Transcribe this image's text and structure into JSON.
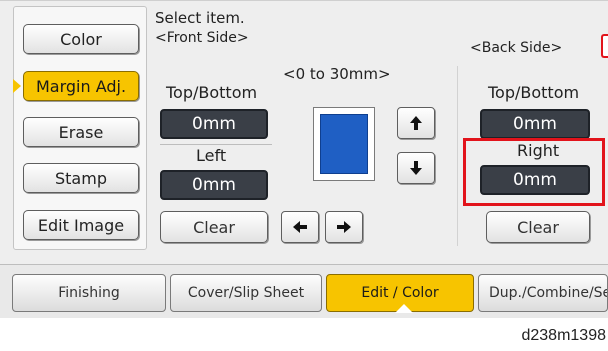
{
  "sidebar": {
    "items": [
      {
        "label": "Color"
      },
      {
        "label": "Margin Adj."
      },
      {
        "label": "Erase"
      },
      {
        "label": "Stamp"
      },
      {
        "label": "Edit Image"
      }
    ]
  },
  "header": {
    "instruction_line1": "Select item.",
    "instruction_line2": "<Front Side>",
    "range": "<0 to 30mm>",
    "back_side": "<Back Side>"
  },
  "front": {
    "top_bottom_label": "Top/Bottom",
    "top_bottom_value": "0mm",
    "left_label": "Left",
    "left_value": "0mm",
    "clear_label": "Clear"
  },
  "back": {
    "top_bottom_label": "Top/Bottom",
    "top_bottom_value": "0mm",
    "right_label": "Right",
    "right_value": "0mm",
    "clear_label": "Clear"
  },
  "tabs": [
    {
      "label": "Finishing"
    },
    {
      "label": "Cover/Slip Sheet"
    },
    {
      "label": "Edit / Color"
    },
    {
      "label": "Dup./Combine/Series"
    }
  ],
  "caption": "d238m1398",
  "colors": {
    "accent": "#f7c400",
    "value_bg": "#3a3f47",
    "highlight": "#e2131b",
    "preview_page": "#1f5fc4"
  },
  "icons": {
    "up": "arrow-up-icon",
    "down": "arrow-down-icon",
    "left": "arrow-left-icon",
    "right": "arrow-right-icon"
  }
}
